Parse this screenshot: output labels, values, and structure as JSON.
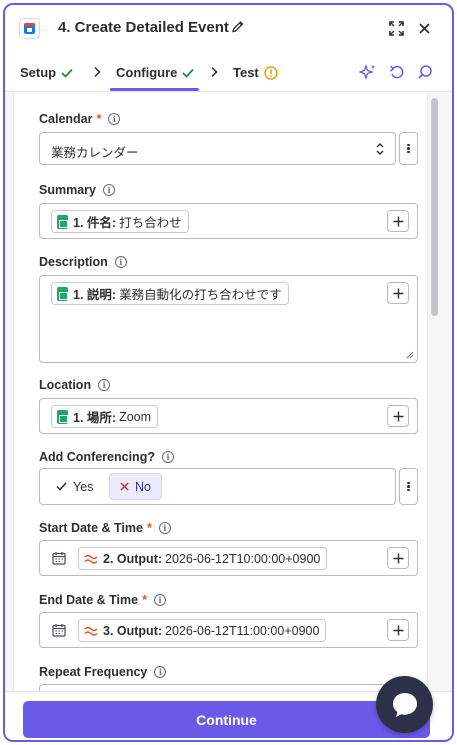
{
  "header": {
    "title": "4. Create Detailed Event",
    "app_icon": "google-calendar-icon",
    "actions": [
      "pencil-icon",
      "expand-icon",
      "close-icon"
    ]
  },
  "tabs": [
    {
      "label": "Setup",
      "status": "check-icon"
    },
    {
      "label": "Configure",
      "status": "check-icon",
      "active": true
    },
    {
      "label": "Test",
      "status": "warning-icon"
    }
  ],
  "toolbar_icons": [
    "ai-sparkle-icon",
    "undo-icon",
    "search-icon"
  ],
  "fields": {
    "calendar": {
      "label": "Calendar",
      "required": "*",
      "value": "業務カレンダー"
    },
    "summary": {
      "label": "Summary",
      "step": "1. 件名:",
      "value": "打ち合わせ"
    },
    "description": {
      "label": "Description",
      "step": "1. 説明:",
      "value": "業務自動化の打ち合わせです"
    },
    "location": {
      "label": "Location",
      "step": "1. 場所:",
      "value": "Zoom"
    },
    "conferencing": {
      "label": "Add Conferencing?",
      "options": [
        "Yes",
        "No"
      ],
      "selected": "No"
    },
    "start": {
      "label": "Start Date & Time",
      "required": "*",
      "step": "2. Output:",
      "value": "2026-06-12T10:00:00+0900"
    },
    "end": {
      "label": "End Date & Time",
      "required": "*",
      "step": "3. Output:",
      "value": "2026-06-12T11:00:00+0900"
    },
    "repeat": {
      "label": "Repeat Frequency"
    }
  },
  "footer": {
    "continue_label": "Continue"
  },
  "colors": {
    "accent": "#695be8",
    "success": "#1f8a4c",
    "warning": "#d9a400",
    "required": "#e5541b",
    "sheets": "#23a566",
    "formatter": "#e5541b"
  }
}
